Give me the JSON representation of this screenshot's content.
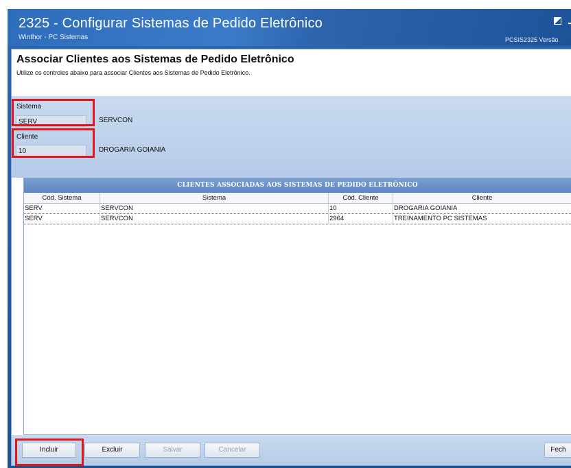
{
  "window": {
    "title": "2325 - Configurar Sistemas de Pedido Eletrônico",
    "subtitle": "Winthor - PC Sistemas",
    "routine_info": "PCSIS2325  Versão"
  },
  "header": {
    "title": "Associar Clientes aos Sistemas de Pedido Eletrônico",
    "description": "Utilize os controles abaixo para associar Clientes aos Sistemas de Pedido Eletrônico."
  },
  "filters": {
    "sistema": {
      "label": "Sistema",
      "value": "SERV",
      "description": "SERVCON"
    },
    "cliente": {
      "label": "Cliente",
      "value": "10",
      "description": "DROGARIA GOIANIA"
    }
  },
  "grid": {
    "title": "CLIENTES ASSOCIADAS AOS SISTEMAS DE PEDIDO ELETRÔNICO",
    "columns": [
      "Cód. Sistema",
      "Sistema",
      "Cód. Cliente",
      "Cliente"
    ],
    "rows": [
      [
        "SERV",
        "SERVCON",
        "10",
        "DROGARIA GOIANIA"
      ],
      [
        "SERV",
        "SERVCON",
        "2964",
        "TREINAMENTO PC SISTEMAS"
      ]
    ]
  },
  "buttons": {
    "incluir": "Incluir",
    "excluir": "Excluir",
    "salvar": "Salvar",
    "cancelar": "Cancelar",
    "fechar": "Fech"
  },
  "colors": {
    "highlight": "#e0161b",
    "title_bar": "#2c67b1",
    "panel": "#c9daf0",
    "grid_header": "#6d93c8"
  }
}
